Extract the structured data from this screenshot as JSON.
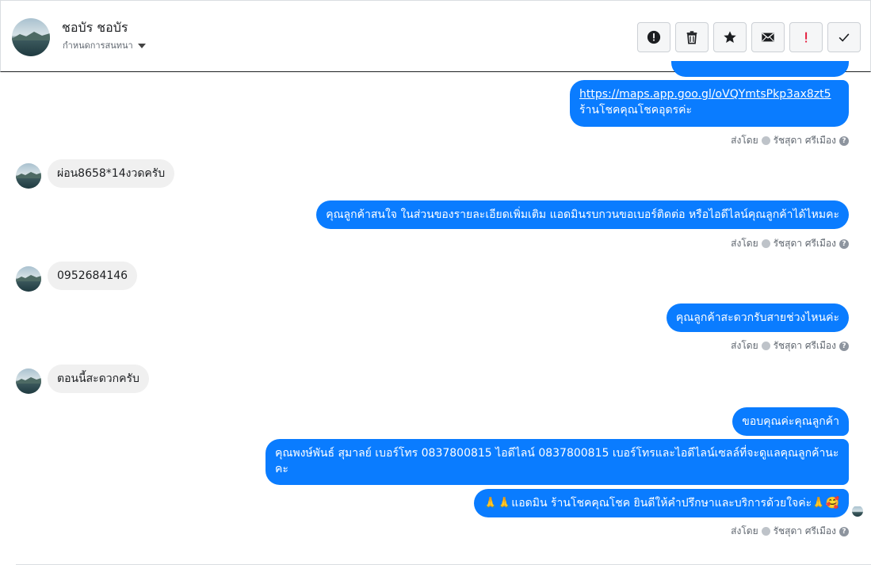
{
  "header": {
    "contact_name": "ชอบัร ชอบัร",
    "assign_label": "กำหนดการสนทนา"
  },
  "toolbar": {
    "buttons": [
      {
        "icon": "alert-circle-icon"
      },
      {
        "icon": "trash-icon"
      },
      {
        "icon": "star-icon"
      },
      {
        "icon": "envelope-icon"
      },
      {
        "icon": "exclamation-icon",
        "text": "!"
      },
      {
        "icon": "check-icon"
      }
    ]
  },
  "messages": [
    {
      "dir": "out",
      "link": "https://maps.app.goo.gl/oVQYmtsPkp3ax8zt5",
      "text": "ร้านโชคคุณโชคอุดรค่ะ"
    },
    {
      "dir": "meta",
      "sent_by": "ส่งโดย",
      "agent": "รัชสุดา ศรีเมือง"
    },
    {
      "dir": "in",
      "text": "ผ่อน8658*14งวดครับ"
    },
    {
      "dir": "out",
      "text": "คุณลูกค้าสนใจ ในส่วนของรายละเอียดเพิ่มเติม แอดมินรบกวนขอเบอร์ติดต่อ หรือไอดีไลน์คุณลูกค้าได้ไหมคะ"
    },
    {
      "dir": "meta",
      "sent_by": "ส่งโดย",
      "agent": "รัชสุดา ศรีเมือง"
    },
    {
      "dir": "in",
      "text": "0952684146"
    },
    {
      "dir": "out",
      "text": "คุณลูกค้าสะดวกรับสายช่วงไหนค่ะ"
    },
    {
      "dir": "meta",
      "sent_by": "ส่งโดย",
      "agent": "รัชสุดา ศรีเมือง"
    },
    {
      "dir": "in",
      "text": "ตอนนี้สะดวกครับ"
    },
    {
      "dir": "out",
      "text": "ขอบคุณค่ะคุณลูกค้า"
    },
    {
      "dir": "out",
      "text": "คุณพงษ์พันธ์ สุมาลย์      เบอร์โทร 0837800815  ไอดีไลน์ 0837800815   เบอร์โทรและไอดีไลน์เซลล์ที่จะดูแลคุณลูกค้านะคะ"
    },
    {
      "dir": "out",
      "text": "🙏🙏แอดมิน ร้านโชคคุณโชค ยินดีให้คำปรึกษาและบริการด้วยใจค่ะ🙏🥰"
    },
    {
      "dir": "meta",
      "sent_by": "ส่งโดย",
      "agent": "รัชสุดา ศรีเมือง"
    }
  ],
  "colors": {
    "outgoing": "#0a7cff",
    "incoming": "#f0f0f0"
  }
}
